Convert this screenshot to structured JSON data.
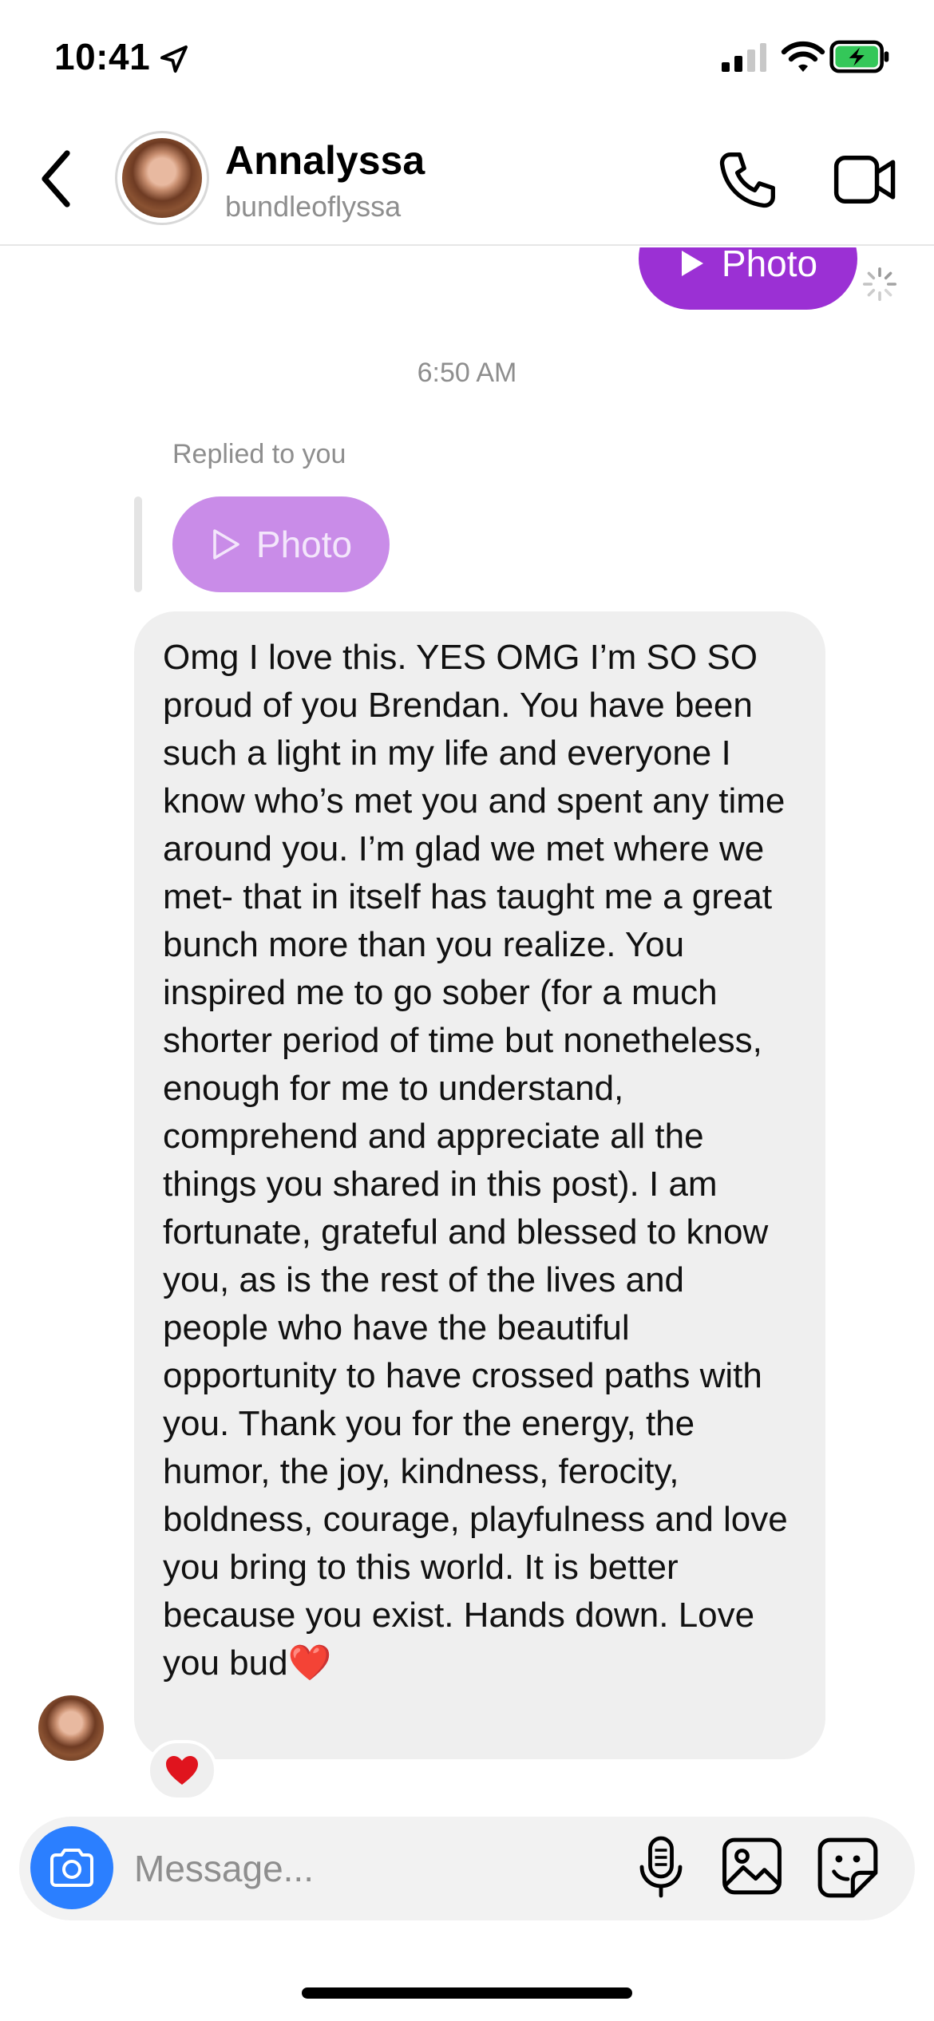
{
  "status_bar": {
    "time": "10:41",
    "battery_color": "#34c759"
  },
  "header": {
    "contact_name": "Annalyssa",
    "contact_handle": "bundleoflyssa"
  },
  "thread": {
    "outgoing_photo_label": "Photo",
    "timestamp": "6:50 AM",
    "replied_label": "Replied to you",
    "quoted_photo_label": "Photo",
    "message_text": "Omg I love this. YES OMG I’m SO SO proud of you Brendan. You have been such a light in my life and everyone I know who’s met you and spent any time around you. I’m glad we met where we met- that in itself has taught me a great bunch more than you realize. You inspired me to go sober (for a much shorter period of time but nonetheless, enough for me to understand, comprehend and appreciate all the things you shared in this post). I am fortunate, grateful and blessed to know you, as is the rest of the lives and people who have the beautiful opportunity to have crossed paths with you. Thank you for the energy, the humor, the joy, kindness, ferocity, boldness, courage, playfulness and love you bring to this world. It is better because you exist. Hands down. Love you bud",
    "message_emoji": "❤️",
    "reaction": "❤️"
  },
  "composer": {
    "placeholder": "Message...",
    "value": ""
  },
  "colors": {
    "accent_purple": "#9b30d4",
    "camera_blue": "#2b7fff",
    "bubble_gray": "#efefef"
  }
}
